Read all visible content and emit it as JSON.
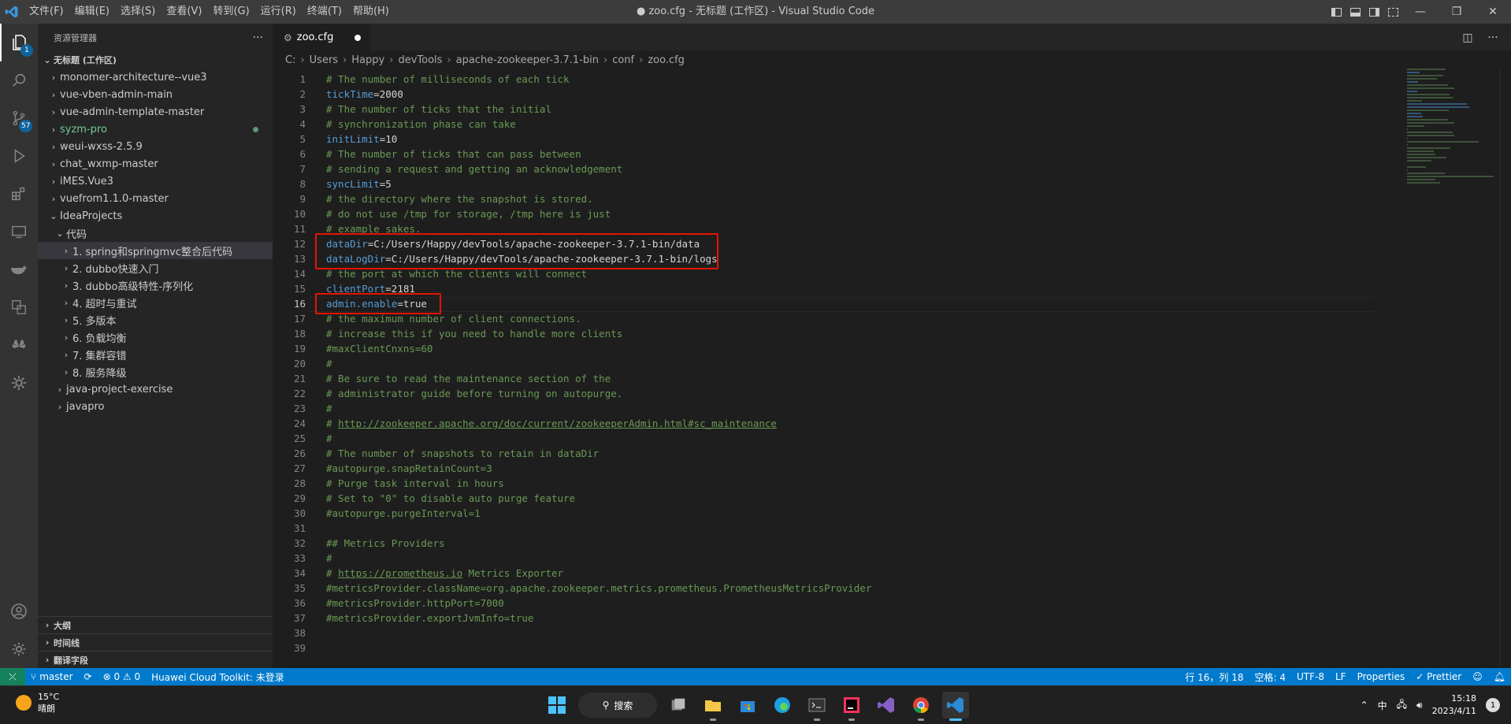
{
  "titlebar": {
    "menu": [
      "文件(F)",
      "编辑(E)",
      "选择(S)",
      "查看(V)",
      "转到(G)",
      "运行(R)",
      "终端(T)",
      "帮助(H)"
    ],
    "title": "● zoo.cfg - 无标题 (工作区) - Visual Studio Code",
    "logo": "vscode-logo"
  },
  "activity": {
    "explorer_badge": "1",
    "scm_badge": "57"
  },
  "sidebar": {
    "header": "资源管理器",
    "more": "···",
    "workspace": "无标题 (工作区)",
    "items": [
      {
        "label": "monomer-architecture--vue3",
        "indent": 1,
        "chev": "›"
      },
      {
        "label": "vue-vben-admin-main",
        "indent": 1,
        "chev": "›"
      },
      {
        "label": "vue-admin-template-master",
        "indent": 1,
        "chev": "›"
      },
      {
        "label": "syzm-pro",
        "indent": 1,
        "chev": "›",
        "modified": true
      },
      {
        "label": "weui-wxss-2.5.9",
        "indent": 1,
        "chev": "›"
      },
      {
        "label": "chat_wxmp-master",
        "indent": 1,
        "chev": "›"
      },
      {
        "label": "iMES.Vue3",
        "indent": 1,
        "chev": "›"
      },
      {
        "label": "vuefrom1.1.0-master",
        "indent": 1,
        "chev": "›"
      },
      {
        "label": "IdeaProjects",
        "indent": 1,
        "chev": "⌄"
      },
      {
        "label": "代码",
        "indent": 2,
        "chev": "⌄"
      },
      {
        "label": "1. spring和springmvc整合后代码",
        "indent": 3,
        "chev": "›",
        "selected": true
      },
      {
        "label": "2. dubbo快速入门",
        "indent": 3,
        "chev": "›"
      },
      {
        "label": "3. dubbo高级特性-序列化",
        "indent": 3,
        "chev": "›"
      },
      {
        "label": "4. 超时与重试",
        "indent": 3,
        "chev": "›"
      },
      {
        "label": "5. 多版本",
        "indent": 3,
        "chev": "›"
      },
      {
        "label": "6. 负载均衡",
        "indent": 3,
        "chev": "›"
      },
      {
        "label": "7. 集群容错",
        "indent": 3,
        "chev": "›"
      },
      {
        "label": "8. 服务降级",
        "indent": 3,
        "chev": "›"
      },
      {
        "label": "java-project-exercise",
        "indent": 2,
        "chev": "›"
      },
      {
        "label": "javapro",
        "indent": 2,
        "chev": "›"
      }
    ],
    "sections": [
      "大纲",
      "时间线",
      "翻译字段"
    ]
  },
  "editor": {
    "tab_label": "zoo.cfg",
    "breadcrumb": [
      "C:",
      "Users",
      "Happy",
      "devTools",
      "apache-zookeeper-3.7.1-bin",
      "conf",
      "zoo.cfg"
    ],
    "current_line": 16,
    "lines": [
      {
        "n": "1",
        "t": "cmt",
        "text": "# The number of milliseconds of each tick"
      },
      {
        "n": "2",
        "t": "kv",
        "key": "tickTime",
        "val": "=2000"
      },
      {
        "n": "3",
        "t": "cmt",
        "text": "# The number of ticks that the initial"
      },
      {
        "n": "4",
        "t": "cmt",
        "text": "# synchronization phase can take"
      },
      {
        "n": "5",
        "t": "kv",
        "key": "initLimit",
        "val": "=10"
      },
      {
        "n": "6",
        "t": "cmt",
        "text": "# The number of ticks that can pass between"
      },
      {
        "n": "7",
        "t": "cmt",
        "text": "# sending a request and getting an acknowledgement"
      },
      {
        "n": "8",
        "t": "kv",
        "key": "syncLimit",
        "val": "=5"
      },
      {
        "n": "9",
        "t": "cmt",
        "text": "# the directory where the snapshot is stored."
      },
      {
        "n": "10",
        "t": "cmt",
        "text": "# do not use /tmp for storage, /tmp here is just"
      },
      {
        "n": "11",
        "t": "cmt",
        "text": "# example sakes."
      },
      {
        "n": "12",
        "t": "kv",
        "key": "dataDir",
        "val": "=C:/Users/Happy/devTools/apache-zookeeper-3.7.1-bin/data"
      },
      {
        "n": "13",
        "t": "kv",
        "key": "dataLogDir",
        "val": "=C:/Users/Happy/devTools/apache-zookeeper-3.7.1-bin/logs"
      },
      {
        "n": "14",
        "t": "cmt",
        "text": "# the port at which the clients will connect"
      },
      {
        "n": "15",
        "t": "kv",
        "key": "clientPort",
        "val": "=2181"
      },
      {
        "n": "16",
        "t": "kv",
        "key": "admin.enable",
        "val": "=true"
      },
      {
        "n": "17",
        "t": "cmt",
        "text": "# the maximum number of client connections."
      },
      {
        "n": "18",
        "t": "cmt",
        "text": "# increase this if you need to handle more clients"
      },
      {
        "n": "19",
        "t": "cmt",
        "text": "#maxClientCnxns=60"
      },
      {
        "n": "20",
        "t": "cmt",
        "text": "#"
      },
      {
        "n": "21",
        "t": "cmt",
        "text": "# Be sure to read the maintenance section of the"
      },
      {
        "n": "22",
        "t": "cmt",
        "text": "# administrator guide before turning on autopurge."
      },
      {
        "n": "23",
        "t": "cmt",
        "text": "#"
      },
      {
        "n": "24",
        "t": "link",
        "pre": "# ",
        "link": "http://zookeeper.apache.org/doc/current/zookeeperAdmin.html#sc_maintenance",
        "post": ""
      },
      {
        "n": "25",
        "t": "cmt",
        "text": "#"
      },
      {
        "n": "26",
        "t": "cmt",
        "text": "# The number of snapshots to retain in dataDir"
      },
      {
        "n": "27",
        "t": "cmt",
        "text": "#autopurge.snapRetainCount=3"
      },
      {
        "n": "28",
        "t": "cmt",
        "text": "# Purge task interval in hours"
      },
      {
        "n": "29",
        "t": "cmt",
        "text": "# Set to \"0\" to disable auto purge feature"
      },
      {
        "n": "30",
        "t": "cmt",
        "text": "#autopurge.purgeInterval=1"
      },
      {
        "n": "31",
        "t": "cmt",
        "text": ""
      },
      {
        "n": "32",
        "t": "cmt",
        "text": "## Metrics Providers"
      },
      {
        "n": "33",
        "t": "cmt",
        "text": "#"
      },
      {
        "n": "34",
        "t": "link",
        "pre": "# ",
        "link": "https://prometheus.io",
        "post": " Metrics Exporter"
      },
      {
        "n": "35",
        "t": "cmt",
        "text": "#metricsProvider.className=org.apache.zookeeper.metrics.prometheus.PrometheusMetricsProvider"
      },
      {
        "n": "36",
        "t": "cmt",
        "text": "#metricsProvider.httpPort=7000"
      },
      {
        "n": "37",
        "t": "cmt",
        "text": "#metricsProvider.exportJvmInfo=true"
      },
      {
        "n": "38",
        "t": "cmt",
        "text": ""
      },
      {
        "n": "39",
        "t": "cmt",
        "text": ""
      }
    ],
    "highlight_line_sets": [
      [
        12,
        13
      ],
      [
        16
      ]
    ]
  },
  "statusbar": {
    "branch": "master",
    "problems": "⊗ 0 ⚠ 0",
    "toolkit": "Huawei Cloud Toolkit: 未登录",
    "position": "行 16，列 18",
    "spaces": "空格: 4",
    "encoding": "UTF-8",
    "eol": "LF",
    "language": "Properties",
    "prettier": "✓ Prettier"
  },
  "taskbar": {
    "temp": "15°C",
    "weather": "晴朗",
    "search": "搜索",
    "ime": "中",
    "time": "15:18",
    "date": "2023/4/11",
    "notifications": "1"
  },
  "colors": {
    "accent": "#007acc",
    "comment": "#6a9955",
    "key": "#569cd6",
    "annotation_red": "#e51400"
  }
}
